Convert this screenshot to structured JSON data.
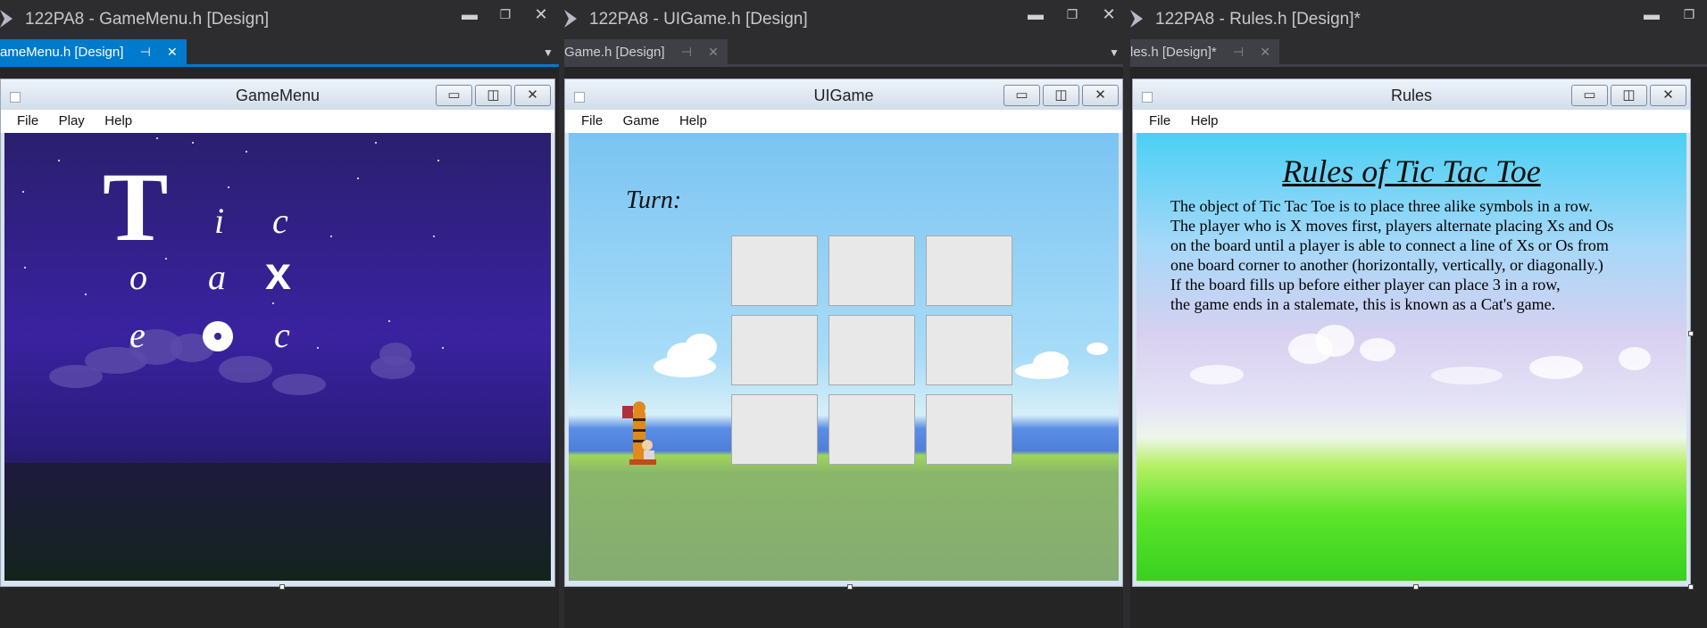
{
  "panes": [
    {
      "vs_title": "122PA8 - GameMenu.h [Design]",
      "tab_label": "ameMenu.h [Design]",
      "form_title": "GameMenu",
      "menu": [
        "File",
        "Play",
        "Help"
      ]
    },
    {
      "vs_title": "122PA8 - UIGame.h [Design]",
      "tab_label": "Game.h [Design]",
      "form_title": "UIGame",
      "menu": [
        "File",
        "Game",
        "Help"
      ],
      "turn_label": "Turn:"
    },
    {
      "vs_title": "122PA8 - Rules.h [Design]*",
      "tab_label": "les.h [Design]*",
      "form_title": "Rules",
      "menu": [
        "File",
        "Help"
      ],
      "rules_title": "Rules of Tic Tac Toe",
      "rules_lines": [
        "The object of Tic Tac Toe is to place three alike symbols in a row.",
        "The player who is X moves first, players alternate placing Xs and Os",
        "on the board until a player is able to connect a line of Xs or Os from",
        "one board corner to another (horizontally, vertically, or diagonally.)",
        "If the board fills up before either player can place 3 in a row,",
        "the game ends in a stalemate, this is known as a Cat's game."
      ]
    }
  ],
  "gamemenu_letters": {
    "t": "T",
    "i": "i",
    "c1": "c",
    "o": "o",
    "a": "a",
    "x": "x",
    "e": "e",
    "c2": "c"
  },
  "icons": {
    "vs_minimize": "▬",
    "vs_maximize": "❐",
    "vs_close": "✕",
    "tab_pin": "⊣",
    "tab_close": "✕",
    "tab_dropdown": "▼",
    "form_minimize": "▭",
    "form_maximize": "◫",
    "form_close": "✕"
  },
  "colors": {
    "vs_chrome": "#2d2d30",
    "tab_active": "#007acc",
    "tab_inactive": "#3f3f46"
  }
}
